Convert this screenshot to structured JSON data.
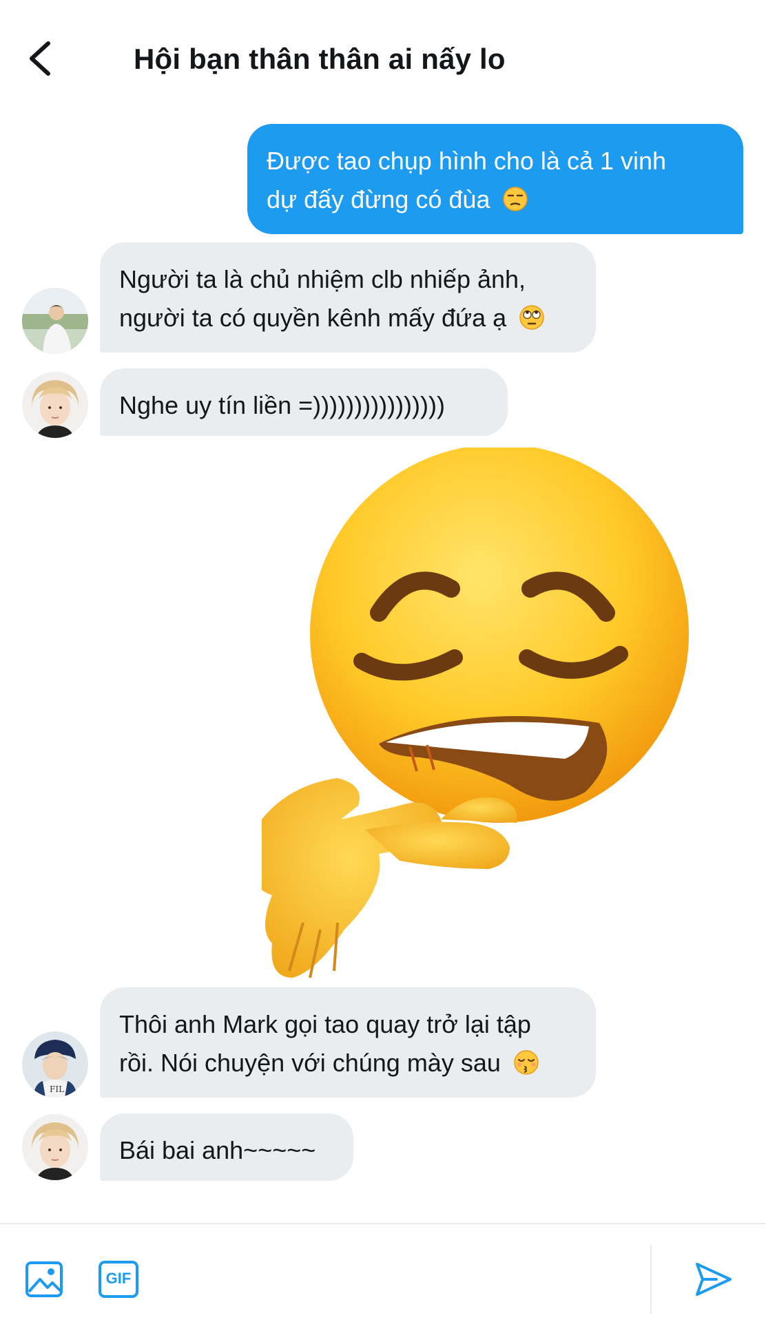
{
  "header": {
    "back_icon": "chevron-left-icon",
    "title": "Hội bạn thân thân ai nấy lo"
  },
  "messages": [
    {
      "direction": "out",
      "line1": "Được tao chụp hình cho là cả 1 vinh",
      "line2": "dự đấy đừng có đùa",
      "emoji": "unamused-face"
    },
    {
      "direction": "in",
      "line1": "Người ta là chủ nhiệm clb nhiếp ảnh,",
      "line2": "người ta có quyền kênh mấy đứa ạ",
      "emoji": "face-with-rolling-eyes"
    },
    {
      "direction": "in",
      "line1": "Nghe uy tín liền =))))))))))))))))"
    },
    {
      "direction": "in",
      "type": "sticker",
      "sticker": "relieved-face-pointing-sticker"
    },
    {
      "direction": "in",
      "line1": "Thôi anh Mark gọi tao quay trở lại tập",
      "line2": "rồi. Nói chuyện với chúng mày sau",
      "emoji": "kissing-face-closed-eyes"
    },
    {
      "direction": "in",
      "line1": "Bái bai anh~~~~~"
    }
  ],
  "composer": {
    "image_icon": "image-icon",
    "gif_label": "GIF",
    "send_icon": "send-icon"
  },
  "colors": {
    "accent": "#1d9bf0",
    "incoming_bubble": "#e9edf0",
    "text": "#14171a"
  }
}
